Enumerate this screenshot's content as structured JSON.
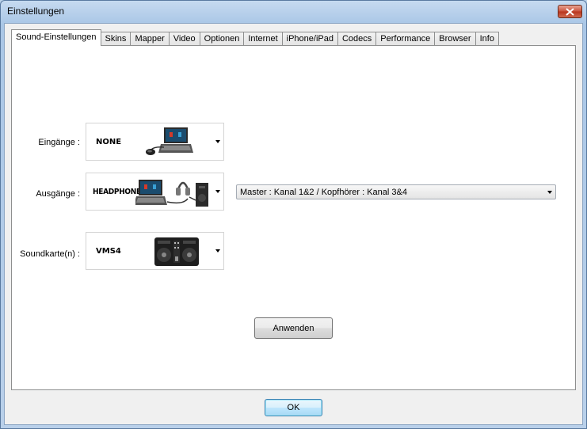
{
  "window": {
    "title": "Einstellungen"
  },
  "tabs": [
    {
      "label": "Sound-Einstellungen",
      "active": true
    },
    {
      "label": "Skins"
    },
    {
      "label": "Mapper"
    },
    {
      "label": "Video"
    },
    {
      "label": "Optionen"
    },
    {
      "label": "Internet"
    },
    {
      "label": "iPhone/iPad"
    },
    {
      "label": "Codecs"
    },
    {
      "label": "Performance"
    },
    {
      "label": "Browser"
    },
    {
      "label": "Info"
    }
  ],
  "sound": {
    "inputs": {
      "label": "Eingänge :",
      "value": "NONE",
      "image_icon": "laptop-with-mouse-icon"
    },
    "outputs": {
      "label": "Ausgänge :",
      "value": "HEADPHONES",
      "image_icon": "laptop-headphones-speaker-icon"
    },
    "soundcard": {
      "label": "Soundkarte(n) :",
      "value": "VMS4",
      "image_icon": "dj-controller-icon"
    },
    "routing": {
      "value": "Master : Kanal 1&2 / Kopfhörer : Kanal 3&4"
    }
  },
  "buttons": {
    "apply": "Anwenden",
    "ok": "OK"
  }
}
